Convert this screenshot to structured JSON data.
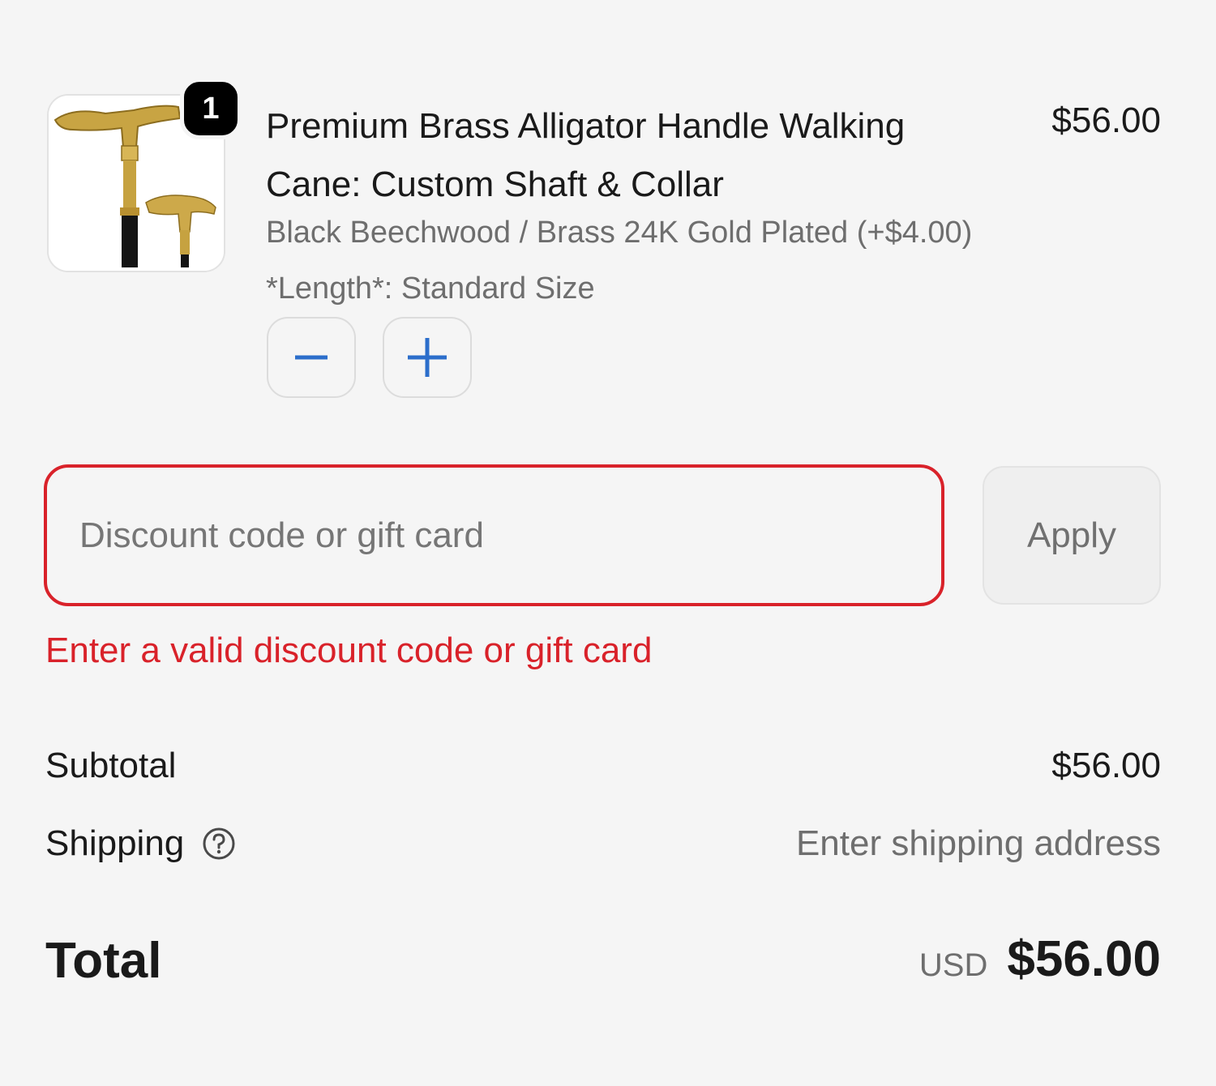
{
  "product": {
    "quantity": "1",
    "title": "Premium Brass Alligator Handle Walking Cane: Custom Shaft & Collar",
    "price": "$56.00",
    "variant": "Black Beechwood / Brass 24K Gold Plated (+$4.00)",
    "length": "*Length*: Standard Size",
    "image_icon": "walking-cane-image"
  },
  "stepper": {
    "decrease_icon": "minus-icon",
    "increase_icon": "plus-icon"
  },
  "discount": {
    "placeholder": "Discount code or gift card",
    "value": "",
    "apply_label": "Apply",
    "error": "Enter a valid discount code or gift card"
  },
  "summary": {
    "subtotal_label": "Subtotal",
    "subtotal_value": "$56.00",
    "shipping_label": "Shipping",
    "shipping_value": "Enter shipping address",
    "help_icon": "question-circle-icon",
    "total_label": "Total",
    "currency": "USD",
    "total_value": "$56.00"
  },
  "colors": {
    "error": "#d9222a",
    "accent": "#2c6ecb",
    "promo": "#2f6b3a"
  }
}
